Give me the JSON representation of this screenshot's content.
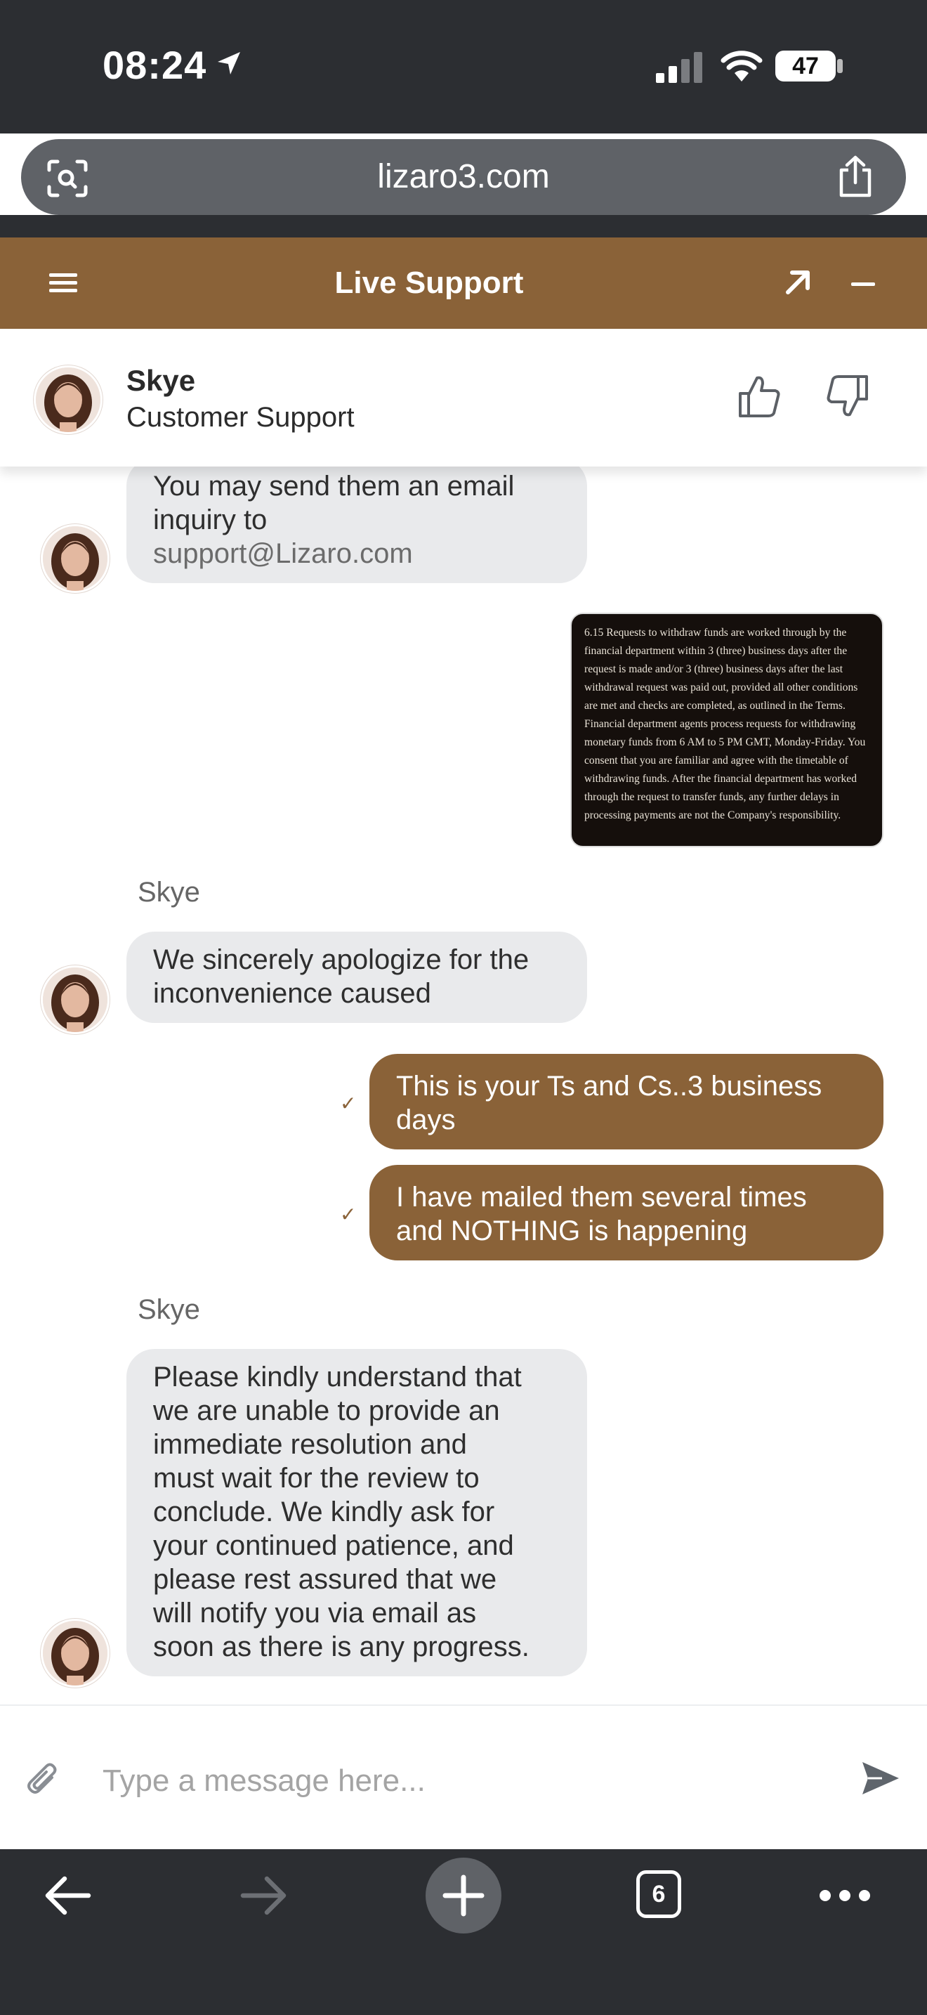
{
  "status_bar": {
    "time": "08:24",
    "battery": "47"
  },
  "browser": {
    "url": "lizaro3.com",
    "tab_count": "6"
  },
  "chat": {
    "header_title": "Live Support",
    "agent": {
      "name": "Skye",
      "role": "Customer Support"
    },
    "messages": [
      {
        "direction": "in",
        "lines": [
          "You may send them an email",
          "inquiry to"
        ],
        "email": "support@Lizaro.com"
      },
      {
        "direction": "out",
        "type": "image",
        "text": "6.15 Requests to withdraw funds are worked through by the financial department within 3 (three) business days after the request is made and/or 3 (three) business days after the last withdrawal request was paid out, provided all other conditions are met and checks are completed, as outlined in the Terms. Financial department agents process requests for withdrawing monetary funds from 6 AM to 5 PM GMT, Monday-Friday. You consent that you are familiar and agree with the timetable of withdrawing funds. After the financial department has worked through the request to transfer funds, any further delays in processing payments are not the Company's responsibility."
      },
      {
        "direction": "in",
        "sender": "Skye",
        "lines": [
          "We sincerely apologize for the",
          "inconvenience caused"
        ]
      },
      {
        "direction": "out",
        "lines": [
          "This is your Ts and Cs..3 business",
          "days"
        ],
        "status": "✓"
      },
      {
        "direction": "out",
        "lines": [
          "I have mailed them several times",
          "and NOTHING is happening"
        ],
        "status": "✓"
      },
      {
        "direction": "in",
        "sender": "Skye",
        "lines": [
          "Please kindly understand that",
          "we are unable to provide an",
          "immediate resolution and",
          "must wait for the review to",
          "conclude. We kindly ask for",
          "your continued patience, and",
          "please rest assured that we",
          "will notify you via email as",
          "soon as there is any progress."
        ]
      }
    ],
    "input_placeholder": "Type a message here..."
  },
  "colors": {
    "brand": "#8a6238",
    "incoming_bubble": "#e9eaec",
    "chrome": "#2c2e32"
  },
  "icons": {
    "status": [
      "location-arrow-icon",
      "signal-icon",
      "wifi-icon",
      "battery-icon"
    ],
    "browser": [
      "visual-search-icon",
      "share-icon",
      "back-icon",
      "forward-icon",
      "new-tab-icon",
      "tabs-icon",
      "more-icon"
    ],
    "chat": [
      "menu-icon",
      "expand-icon",
      "minimize-icon",
      "thumbs-up-icon",
      "thumbs-down-icon",
      "attach-icon",
      "send-icon"
    ]
  }
}
